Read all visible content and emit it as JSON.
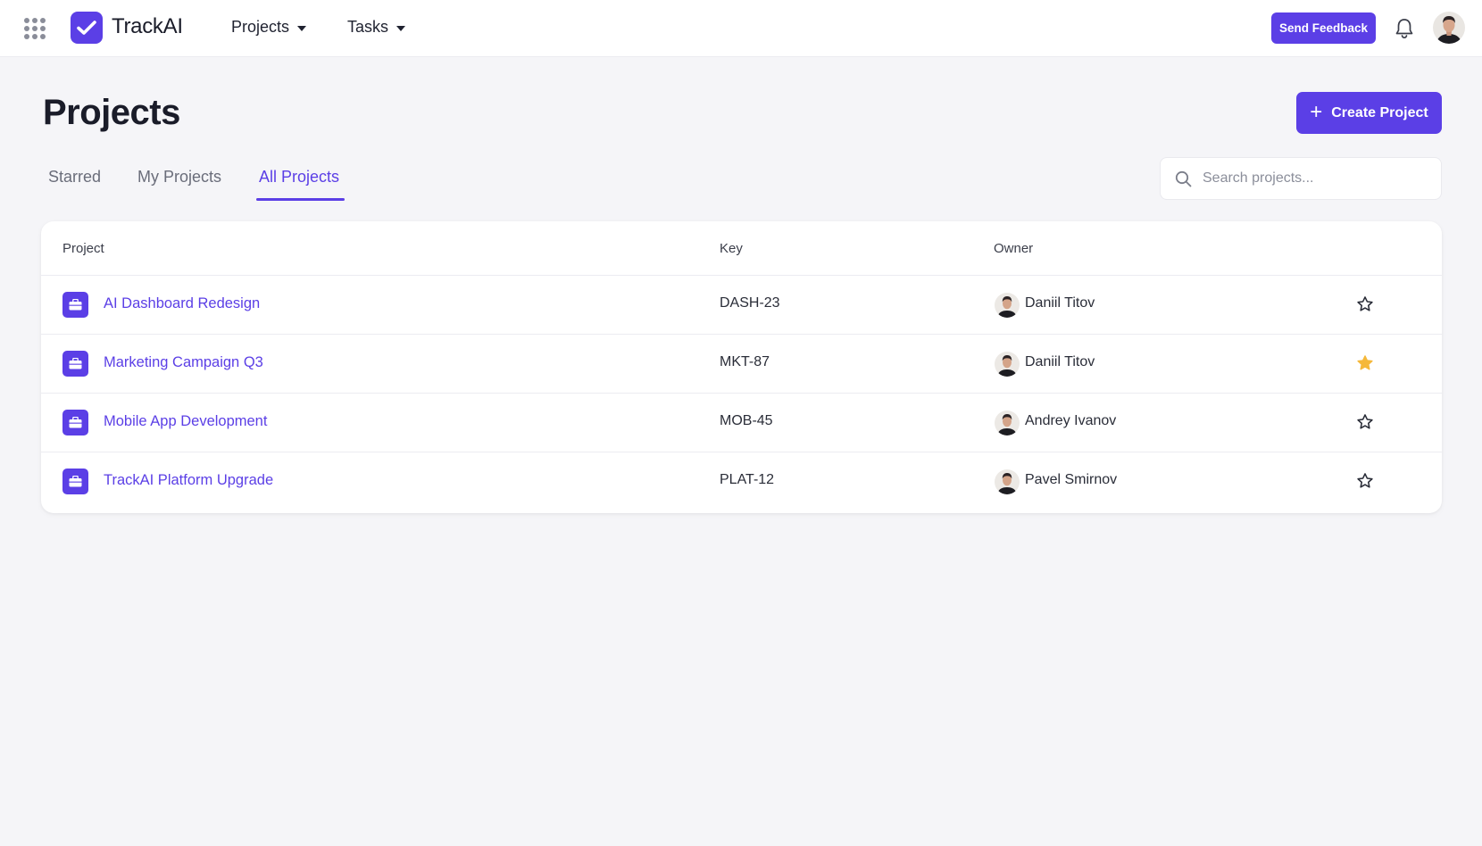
{
  "header": {
    "app_name": "TrackAI",
    "nav": [
      {
        "label": "Projects"
      },
      {
        "label": "Tasks"
      }
    ],
    "feedback_label": "Send Feedback",
    "brand_color": "#5b3fe6"
  },
  "page": {
    "title": "Projects",
    "create_label": "Create Project"
  },
  "tabs": [
    {
      "label": "Starred",
      "active": false
    },
    {
      "label": "My Projects",
      "active": false
    },
    {
      "label": "All Projects",
      "active": true
    }
  ],
  "search": {
    "placeholder": "Search projects...",
    "value": ""
  },
  "table": {
    "columns": [
      "Project",
      "Key",
      "Owner"
    ],
    "rows": [
      {
        "name": "AI Dashboard Redesign",
        "key": "DASH-23",
        "owner": "Daniil Titov",
        "starred": false
      },
      {
        "name": "Marketing Campaign Q3",
        "key": "MKT-87",
        "owner": "Daniil Titov",
        "starred": true
      },
      {
        "name": "Mobile App Development",
        "key": "MOB-45",
        "owner": "Andrey Ivanov",
        "starred": false
      },
      {
        "name": "TrackAI Platform Upgrade",
        "key": "PLAT-12",
        "owner": "Pavel Smirnov",
        "starred": false
      }
    ]
  },
  "icons": {
    "apps": "apps-grid-icon",
    "logo": "checkmark-logo-icon",
    "bell": "bell-icon",
    "search": "search-icon",
    "project": "briefcase-icon",
    "star": "star-icon"
  },
  "colors": {
    "accent": "#5b3fe6",
    "star_active": "#f5b83a",
    "background": "#f5f5f8"
  }
}
